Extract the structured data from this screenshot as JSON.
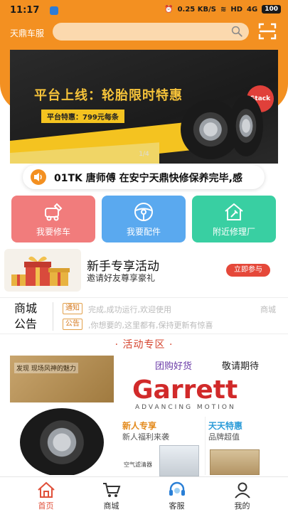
{
  "status_bar": {
    "time": "11:17",
    "speed": "0.25 KB/S",
    "network": "HD",
    "signal": "4G",
    "battery": "100"
  },
  "header": {
    "brand": "天鼎车服",
    "search_placeholder": "",
    "icons": [
      "search-icon",
      "scan-icon"
    ],
    "accent_color": "#f39021"
  },
  "banner": {
    "title": "平台上线：轮胎限时特惠",
    "subtitle": "平台特惠：799元每条",
    "badge": "Stack",
    "pager": "1/4"
  },
  "notice": {
    "text": "01TK 唐师傅 在安宁天鼎快修保养完毕,感"
  },
  "quick_actions": [
    {
      "label": "我要修车",
      "icon": "repair-icon",
      "color": "#f17c7c"
    },
    {
      "label": "我要配件",
      "icon": "steering-wheel-icon",
      "color": "#5aa9ef"
    },
    {
      "label": "附近修理厂",
      "icon": "garage-icon",
      "color": "#39cfa2"
    }
  ],
  "promo": {
    "title": "新手专享活动",
    "subtitle": "邀请好友尊享豪礼",
    "button": "立即参与"
  },
  "announcement": {
    "heading_line1": "商城",
    "heading_line2": "公告",
    "items": [
      {
        "tag": "通知",
        "text": "完成,成功运行,欢迎使用",
        "extra": "商城"
      },
      {
        "tag": "公告",
        "text": ",你想要的,这里都有,保持更新有惊喜",
        "extra": ""
      }
    ]
  },
  "activity": {
    "section_title": "· 活动专区 ·",
    "left_caption": "发现 现场风神的魅力",
    "group_buy": "团购好货",
    "coming_soon": "敬请期待",
    "brand_logo": "Garrett",
    "brand_tagline": "ADVANCING MOTION",
    "newcomer_title": "新人专享",
    "newcomer_sub": "新人福利来袭",
    "daily_title": "天天特惠",
    "daily_sub": "品牌超值",
    "filter_label": "空气滤清器"
  },
  "tabbar": {
    "items": [
      {
        "label": "首页",
        "icon": "home-icon",
        "active": true
      },
      {
        "label": "商城",
        "icon": "cart-icon",
        "active": false
      },
      {
        "label": "客服",
        "icon": "headset-icon",
        "active": false
      },
      {
        "label": "我的",
        "icon": "profile-icon",
        "active": false
      }
    ],
    "active_color": "#e0503a"
  }
}
